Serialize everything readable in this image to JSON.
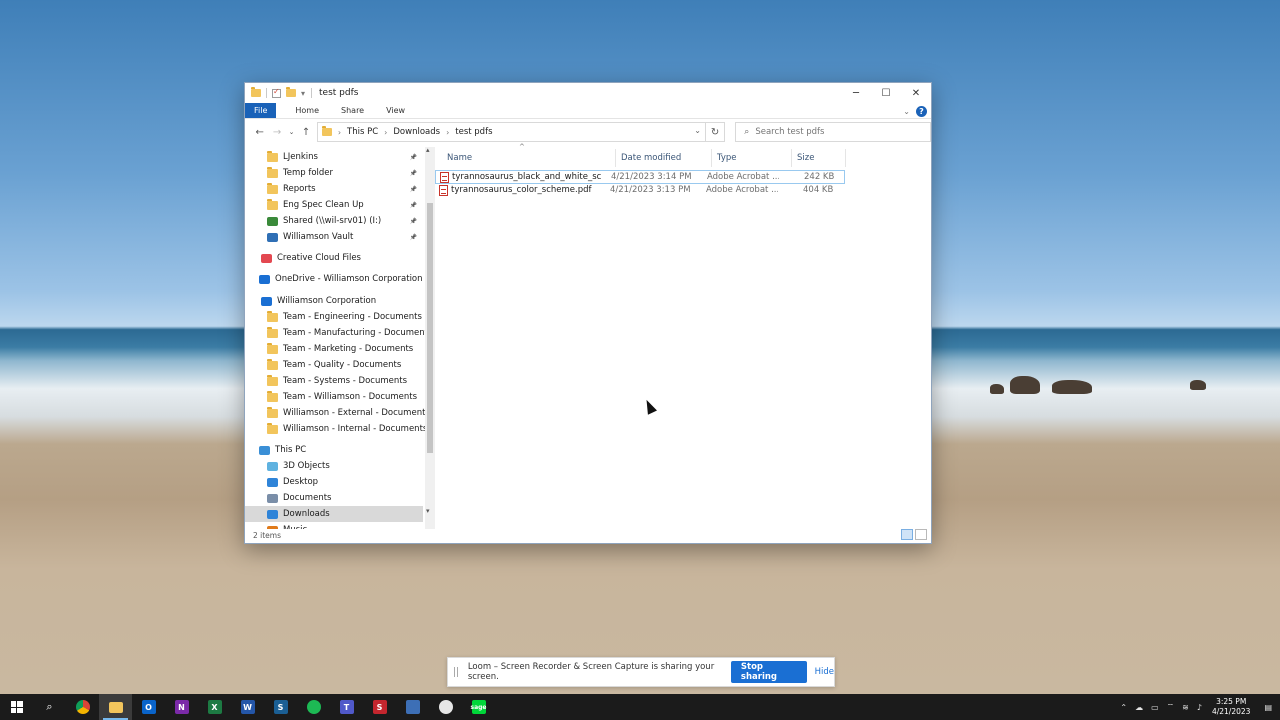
{
  "window": {
    "title": "test pdfs",
    "tabs": [
      "File",
      "Home",
      "Share",
      "View"
    ],
    "breadcrumb": [
      "This PC",
      "Downloads",
      "test pdfs"
    ],
    "search_placeholder": "Search test pdfs",
    "status": "2 items"
  },
  "nav": {
    "items": [
      {
        "label": "LJenkins",
        "icon": "folder-icon",
        "pinned": true
      },
      {
        "label": "Temp folder",
        "icon": "folder-icon",
        "pinned": true
      },
      {
        "label": "Reports",
        "icon": "folder-icon",
        "pinned": true
      },
      {
        "label": "Eng Spec Clean Up",
        "icon": "folder-icon",
        "pinned": true
      },
      {
        "label": "Shared (\\\\wil-srv01) (I:)",
        "icon": "network-drive-icon",
        "pinned": true
      },
      {
        "label": "Williamson Vault",
        "icon": "vault-icon",
        "pinned": true
      },
      {
        "label": "Creative Cloud Files",
        "icon": "creative-cloud-icon",
        "pinned": false
      },
      {
        "label": "OneDrive - Williamson Corporation",
        "icon": "onedrive-icon",
        "pinned": false
      },
      {
        "label": "Williamson Corporation",
        "icon": "sharepoint-icon",
        "pinned": false
      },
      {
        "label": "Team - Engineering - Documents",
        "icon": "folder-icon",
        "pinned": false
      },
      {
        "label": "Team - Manufacturing - Documents",
        "icon": "folder-icon",
        "pinned": false
      },
      {
        "label": "Team - Marketing - Documents",
        "icon": "folder-icon",
        "pinned": false
      },
      {
        "label": "Team - Quality - Documents",
        "icon": "folder-icon",
        "pinned": false
      },
      {
        "label": "Team - Systems - Documents",
        "icon": "folder-icon",
        "pinned": false
      },
      {
        "label": "Team - Williamson - Documents",
        "icon": "folder-icon",
        "pinned": false
      },
      {
        "label": "Williamson - External - Documents",
        "icon": "folder-icon",
        "pinned": false
      },
      {
        "label": "Williamson - Internal - Documents",
        "icon": "folder-icon",
        "pinned": false
      },
      {
        "label": "This PC",
        "icon": "computer-icon",
        "pinned": false
      },
      {
        "label": "3D Objects",
        "icon": "3d-objects-icon",
        "pinned": false
      },
      {
        "label": "Desktop",
        "icon": "desktop-icon",
        "pinned": false
      },
      {
        "label": "Documents",
        "icon": "documents-icon",
        "pinned": false
      },
      {
        "label": "Downloads",
        "icon": "downloads-icon",
        "pinned": false,
        "selected": true
      },
      {
        "label": "Music",
        "icon": "music-icon",
        "pinned": false
      }
    ]
  },
  "columns": [
    "Name",
    "Date modified",
    "Type",
    "Size"
  ],
  "files": [
    {
      "name": "tyrannosaurus_black_and_white_sche...",
      "date": "4/21/2023 3:14 PM",
      "type": "Adobe Acrobat ...",
      "size": "242 KB"
    },
    {
      "name": "tyrannosaurus_color_scheme.pdf",
      "date": "4/21/2023 3:13 PM",
      "type": "Adobe Acrobat ...",
      "size": "404 KB"
    }
  ],
  "loom": {
    "message": "Loom – Screen Recorder & Screen Capture is sharing your screen.",
    "stop": "Stop sharing",
    "hide": "Hide"
  },
  "taskbar": {
    "apps": [
      "start-icon",
      "search-icon",
      "chrome-icon",
      "file-explorer-icon",
      "outlook-icon",
      "onenote-icon",
      "excel-icon",
      "word-icon",
      "sketchup-icon",
      "spotify-icon",
      "teams-icon",
      "solidworks-icon",
      "vault-icon",
      "paint-icon",
      "sage-icon"
    ],
    "time": "3:25 PM",
    "date": "4/21/2023"
  },
  "colors": {
    "accent": "#1a62b8",
    "folder": "#f2c55c",
    "selection": "#d9d9d9"
  }
}
